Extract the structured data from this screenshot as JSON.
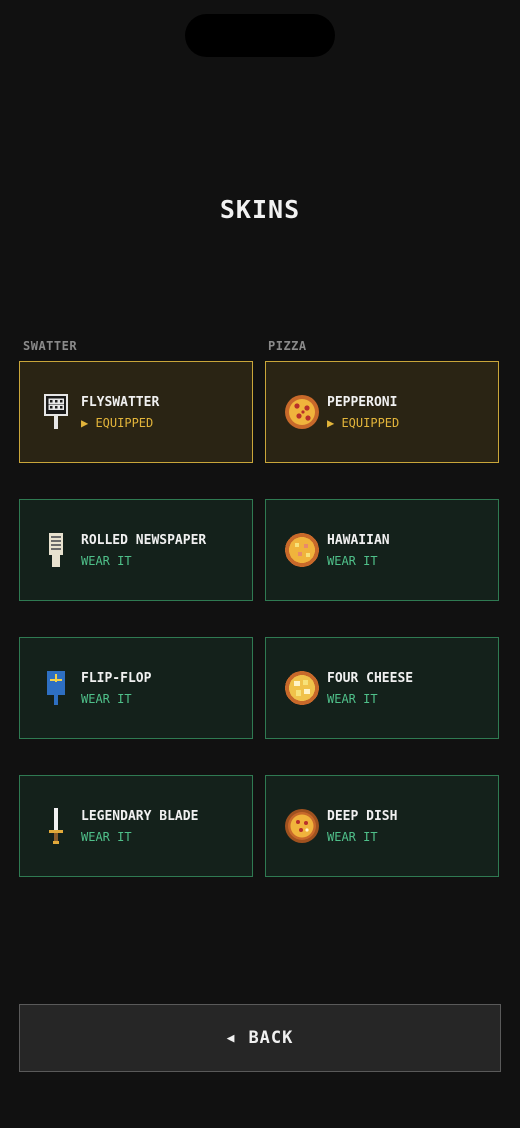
{
  "page": {
    "title": "SKINS"
  },
  "columns": {
    "swatter": {
      "header": "SWATTER"
    },
    "pizza": {
      "header": "PIZZA"
    }
  },
  "swatter_items": [
    {
      "name": "FLYSWATTER",
      "status": "▶ EQUIPPED",
      "icon": "flyswatter-icon",
      "equipped": true
    },
    {
      "name": "ROLLED NEWSPAPER",
      "status": "WEAR IT",
      "icon": "newspaper-icon",
      "equipped": false
    },
    {
      "name": "FLIP-FLOP",
      "status": "WEAR IT",
      "icon": "flip-flop-icon",
      "equipped": false
    },
    {
      "name": "LEGENDARY BLADE",
      "status": "WEAR IT",
      "icon": "sword-icon",
      "equipped": false
    }
  ],
  "pizza_items": [
    {
      "name": "PEPPERONI",
      "status": "▶ EQUIPPED",
      "icon": "pepperoni-pizza-icon",
      "equipped": true
    },
    {
      "name": "HAWAIIAN",
      "status": "WEAR IT",
      "icon": "hawaiian-pizza-icon",
      "equipped": false
    },
    {
      "name": "FOUR CHEESE",
      "status": "WEAR IT",
      "icon": "four-cheese-pizza-icon",
      "equipped": false
    },
    {
      "name": "DEEP DISH",
      "status": "WEAR IT",
      "icon": "deep-dish-pizza-icon",
      "equipped": false
    }
  ],
  "back_button": {
    "arrow": "◀",
    "label": "BACK"
  },
  "colors": {
    "background": "#111111",
    "equipped_border": "#c9a63a",
    "equipped_text": "#e2b43a",
    "available_border": "#2f7a52",
    "available_text": "#4fc08a"
  }
}
